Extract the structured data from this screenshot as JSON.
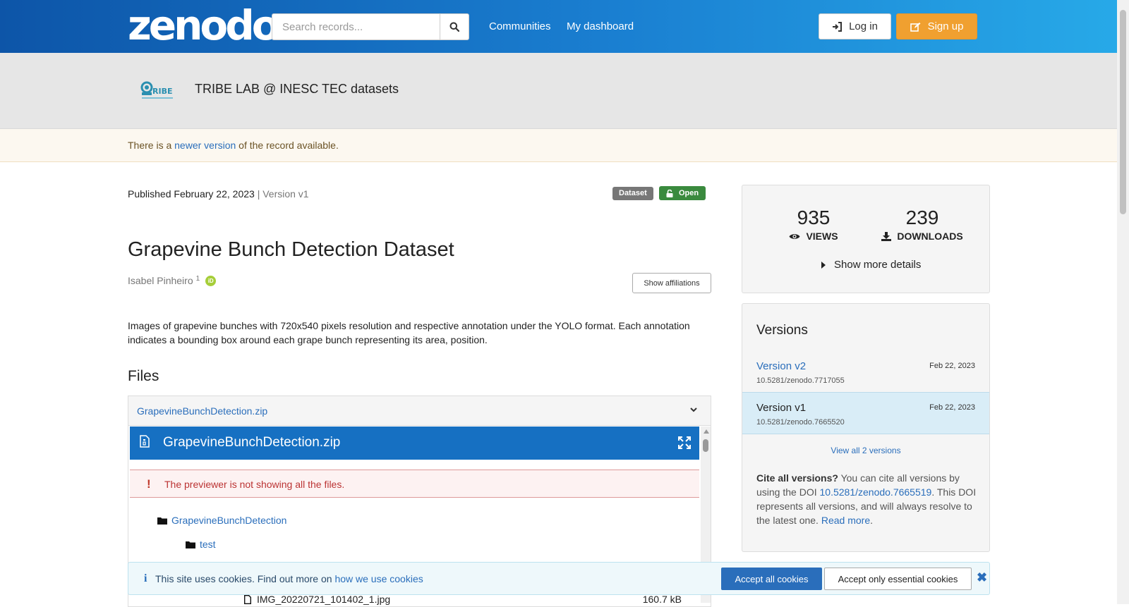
{
  "header": {
    "logo_text": "zenodo",
    "search_placeholder": "Search records...",
    "nav": [
      "Communities",
      "My dashboard"
    ],
    "login_label": "Log in",
    "signup_label": "Sign up"
  },
  "community": {
    "name": "TRIBE LAB @ INESC TEC datasets"
  },
  "notice": {
    "prefix": "There is a ",
    "link": "newer version",
    "suffix": " of the record available."
  },
  "record": {
    "published_label": "Published",
    "published_date": "February 22, 2023",
    "version_text": "| Version v1",
    "resource_type": "Dataset",
    "access": "Open",
    "title": "Grapevine Bunch Detection Dataset",
    "author": "Isabel Pinheiro",
    "author_affil_sup": "1",
    "orcid_label": "iD",
    "show_affiliations": "Show affiliations",
    "description": "Images of grapevine bunches with 720x540 pixels resolution and respective annotation under the YOLO format. Each annotation indicates a bounding box around each grape bunch representing its area, position."
  },
  "files": {
    "heading": "Files",
    "archive_name": "GrapevineBunchDetection.zip",
    "preview_title": "GrapevineBunchDetection.zip",
    "previewer_warning": "The previewer is not showing all the files.",
    "tree": [
      {
        "name": "GrapevineBunchDetection"
      },
      {
        "name": "test"
      }
    ],
    "visible_file": {
      "name": "IMG_20220721_101402_1.jpg",
      "size": "160.7 kB"
    }
  },
  "stats": {
    "views": "935",
    "views_label": "VIEWS",
    "downloads": "239",
    "downloads_label": "DOWNLOADS",
    "more_details": "Show more details"
  },
  "versions": {
    "title": "Versions",
    "items": [
      {
        "name": "Version v2",
        "date": "Feb 22, 2023",
        "doi": "10.5281/zenodo.7717055"
      },
      {
        "name": "Version v1",
        "date": "Feb 22, 2023",
        "doi": "10.5281/zenodo.7665520"
      }
    ],
    "view_all": "View all 2 versions",
    "cite_bold": "Cite all versions?",
    "cite_text1": " You can cite all versions by using the DOI ",
    "cite_doi": "10.5281/zenodo.7665519",
    "cite_text2": ". This DOI represents all versions, and will always resolve to the latest one. ",
    "read_more": "Read more",
    "cite_end": "."
  },
  "cookies": {
    "text": "This site uses cookies. Find out more on ",
    "link": "how we use cookies",
    "accept_all": "Accept all cookies",
    "accept_essential": "Accept only essential cookies",
    "close": "✖"
  },
  "colors": {
    "header_gradient_start": "#0d55a8",
    "header_gradient_end": "#27a9e8",
    "link": "#2a6ebb",
    "signup": "#f0a030",
    "open_badge": "#3a8a3e",
    "preview_bar": "#1670c2"
  }
}
